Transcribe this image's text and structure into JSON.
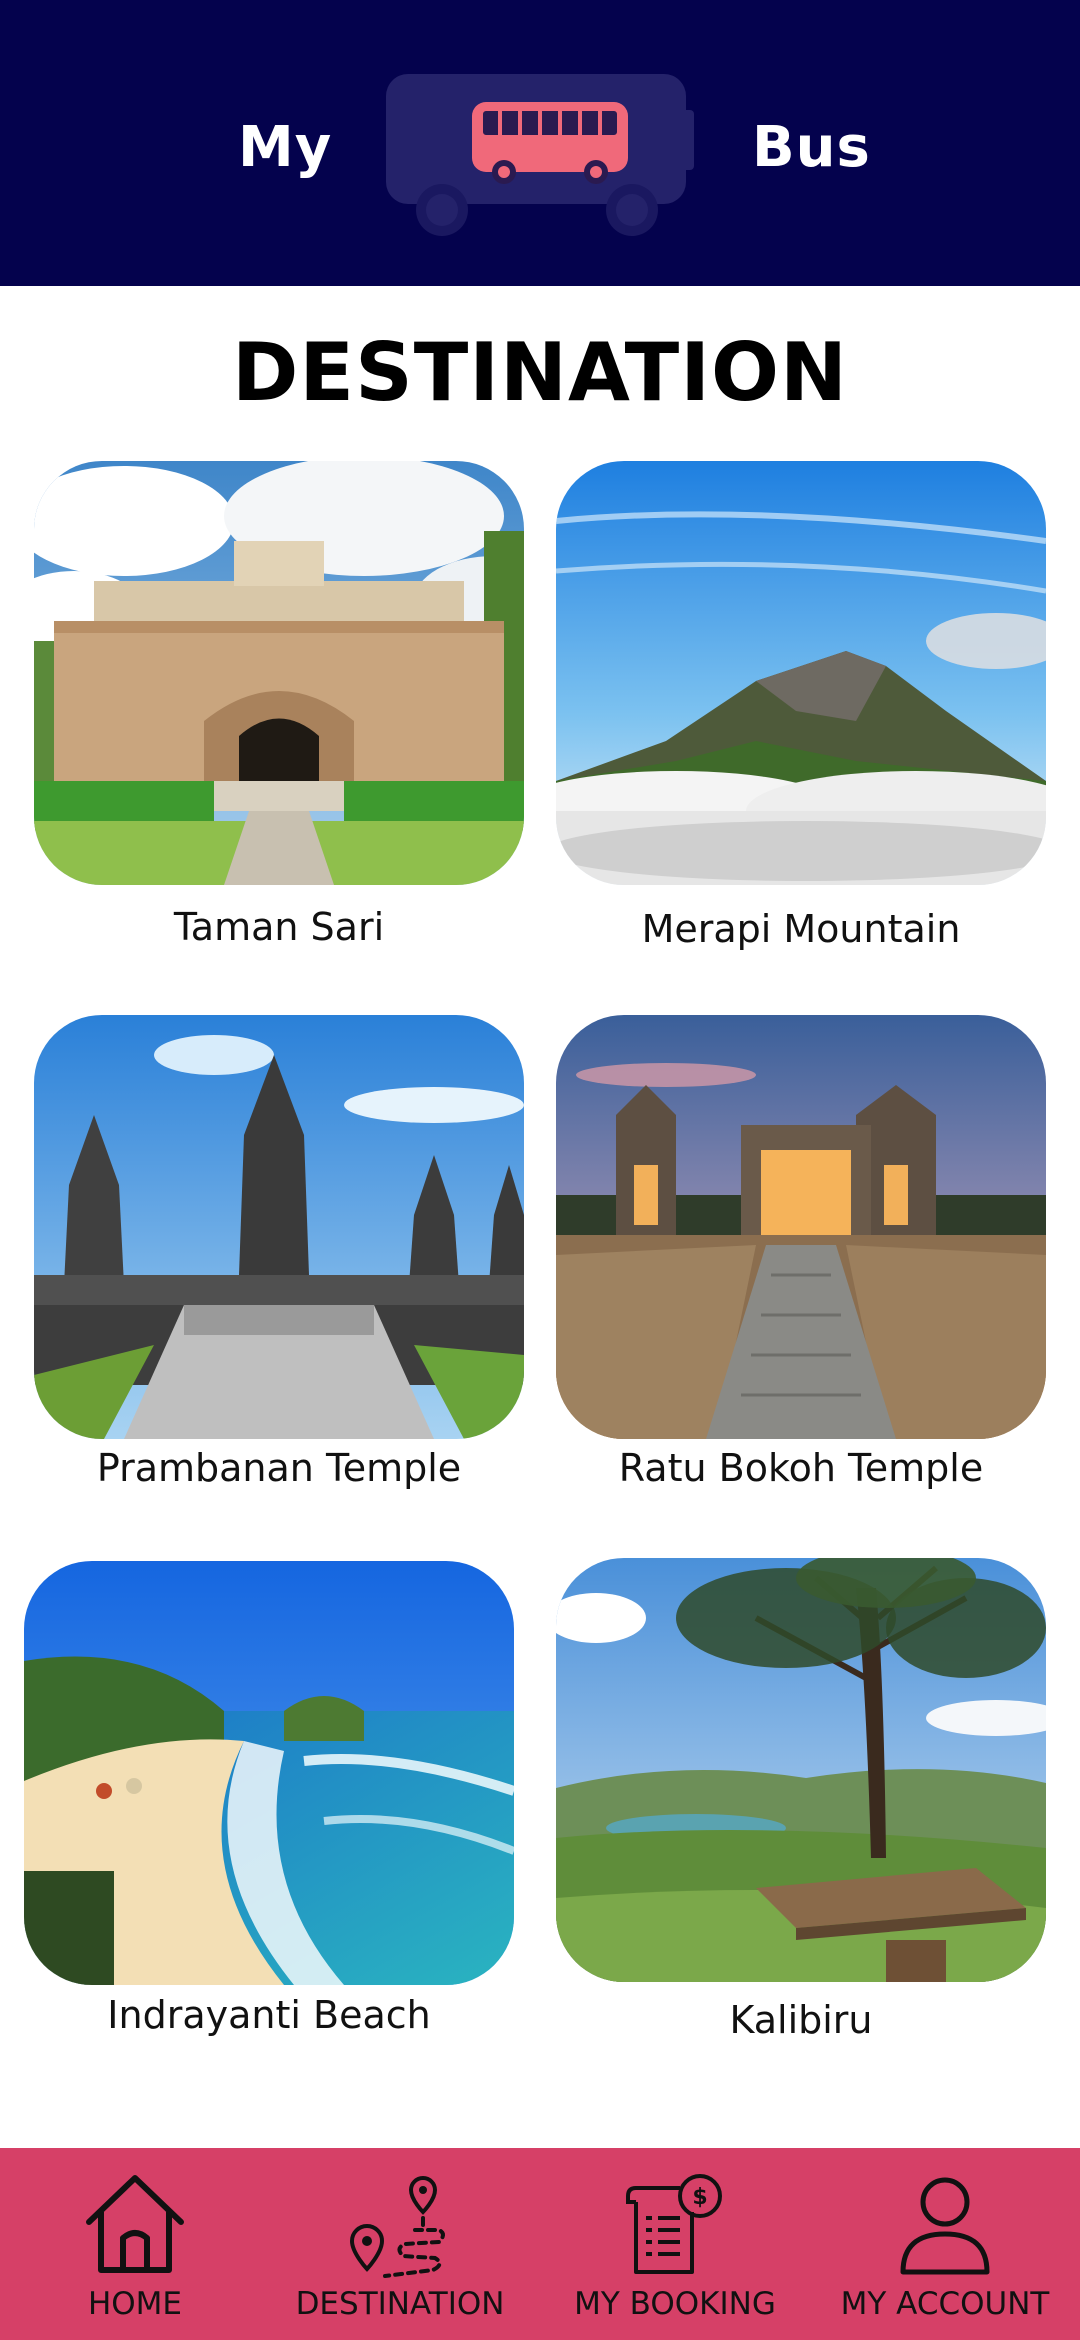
{
  "header": {
    "title_left": "My",
    "title_right": "Bus",
    "logo_icon": "bus-icon",
    "background_color": "#04024d",
    "accent_color": "#f0697a"
  },
  "page": {
    "title": "DESTINATION"
  },
  "destinations": [
    {
      "name": "Taman Sari"
    },
    {
      "name": "Merapi Mountain"
    },
    {
      "name": "Prambanan Temple"
    },
    {
      "name": "Ratu Bokoh Temple"
    },
    {
      "name": "Indrayanti Beach"
    },
    {
      "name": "Kalibiru"
    }
  ],
  "bottom_nav": {
    "background_color": "#d64067",
    "items": [
      {
        "label": "HOME",
        "icon": "home-icon"
      },
      {
        "label": "DESTINATION",
        "icon": "route-pin-icon"
      },
      {
        "label": "MY BOOKING",
        "icon": "receipt-dollar-icon"
      },
      {
        "label": "MY ACCOUNT",
        "icon": "user-icon"
      }
    ]
  }
}
